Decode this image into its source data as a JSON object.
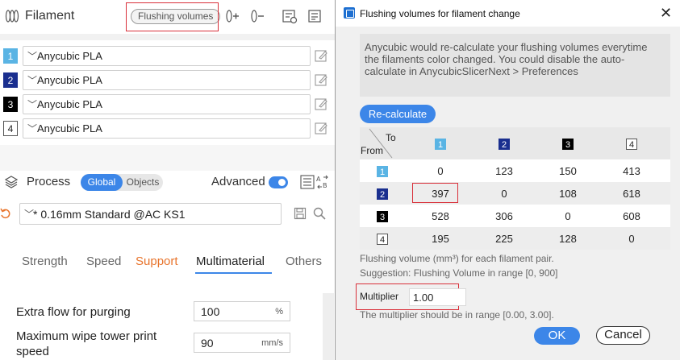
{
  "left": {
    "filament": {
      "title": "Filament",
      "flushing_button": "Flushing volumes",
      "rows": [
        {
          "num": "1",
          "name": "Anycubic PLA",
          "badge_bg": "#5ab4e4",
          "badge_fg": "#ffffff"
        },
        {
          "num": "2",
          "name": "Anycubic PLA",
          "badge_bg": "#1a2f8f",
          "badge_fg": "#ffffff"
        },
        {
          "num": "3",
          "name": "Anycubic PLA",
          "badge_bg": "#000000",
          "badge_fg": "#ffffff"
        },
        {
          "num": "4",
          "name": "Anycubic PLA",
          "badge_bg": "#ffffff",
          "badge_fg": "#222222"
        }
      ]
    },
    "process": {
      "title": "Process",
      "global": "Global",
      "objects": "Objects",
      "advanced": "Advanced",
      "advanced_on": true,
      "preset": "* 0.16mm Standard @AC KS1"
    },
    "tabs": [
      {
        "label": "Strength",
        "state": "normal"
      },
      {
        "label": "Speed",
        "state": "normal"
      },
      {
        "label": "Support",
        "state": "warning"
      },
      {
        "label": "Multimaterial",
        "state": "active"
      },
      {
        "label": "Others",
        "state": "normal"
      }
    ],
    "settings": [
      {
        "label": "Extra flow for purging",
        "value": "100",
        "unit": "%"
      },
      {
        "label": "Maximum wipe tower print speed",
        "value": "90",
        "unit": "mm/s"
      }
    ]
  },
  "dialog": {
    "title": "Flushing volumes for filament change",
    "info": "Anycubic would re-calculate your flushing volumes everytime the filaments color changed. You could disable the auto-calculate in AnycubicSlicerNext > Preferences",
    "recalculate": "Re-calculate",
    "matrix": {
      "to_label": "To",
      "from_label": "From",
      "headers": [
        "1",
        "2",
        "3",
        "4"
      ],
      "rows": [
        {
          "from": "1",
          "values": [
            "0",
            "123",
            "150",
            "413"
          ]
        },
        {
          "from": "2",
          "values": [
            "397",
            "0",
            "108",
            "618"
          ]
        },
        {
          "from": "3",
          "values": [
            "528",
            "306",
            "0",
            "608"
          ]
        },
        {
          "from": "4",
          "values": [
            "195",
            "225",
            "128",
            "0"
          ]
        }
      ]
    },
    "hint1": "Flushing volume (mm³) for each filament pair.",
    "hint2": "Suggestion: Flushing Volume in range [0, 900]",
    "multiplier_label": "Multiplier",
    "multiplier_value": "1.00",
    "multiplier_hint": "The multiplier should be in range [0.00, 3.00].",
    "ok": "OK",
    "cancel": "Cancel"
  },
  "colors": {
    "accent": "#3c86e8",
    "highlight": "#d9303a",
    "warning_tab": "#e8742c"
  },
  "icons": [
    "filament-icon",
    "add-filament-icon",
    "remove-filament-icon",
    "filament-settings-icon",
    "edit-icon",
    "process-icon",
    "list-icon",
    "compare-icon",
    "undo-icon",
    "save-icon",
    "search-icon",
    "app-icon",
    "close-icon"
  ]
}
